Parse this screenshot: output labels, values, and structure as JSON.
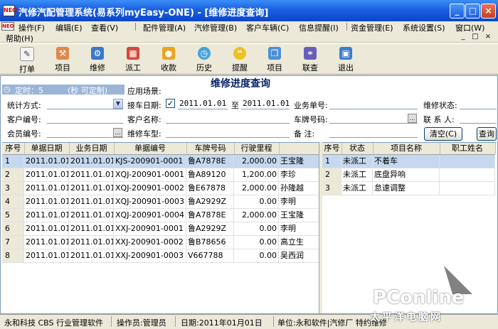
{
  "window": {
    "title": "汽修汽配管理系统(易系列myEasy-ONE) - [维修进度查询]",
    "controls": [
      "_",
      "□",
      "×"
    ]
  },
  "menu": {
    "items": [
      "操作(F)",
      "编辑(E)",
      "查看(V)",
      "配件管理(A)",
      "汽修管理(B)",
      "客户车辆(C)",
      "信息提醒(I)",
      "资金管理(E)",
      "系统设置(S)",
      "窗口(W)",
      "帮助(H)"
    ],
    "mdi_controls": [
      "_",
      "□",
      "×"
    ]
  },
  "toolbar": {
    "buttons": [
      {
        "label": "打单",
        "icon": "print-order-icon"
      },
      {
        "label": "项目",
        "icon": "hammer-icon"
      },
      {
        "label": "维修",
        "icon": "repair-icon"
      },
      {
        "label": "派工",
        "icon": "calendar-icon"
      },
      {
        "label": "收款",
        "icon": "payment-icon"
      },
      {
        "label": "历史",
        "icon": "clock-icon"
      },
      {
        "label": "提醒",
        "icon": "reminder-icon"
      },
      {
        "label": "项目",
        "icon": "project-icon"
      },
      {
        "label": "联查",
        "icon": "linked-query-icon"
      },
      {
        "label": "退出",
        "icon": "exit-icon"
      }
    ]
  },
  "form": {
    "title": "维修进度查询",
    "timer_label": "定时：5",
    "timer_hint": "(秒 可定制)",
    "scene_label": "应用场景:",
    "stat_mode_label": "统计方式:",
    "pickup_date_label": "接车日期:",
    "pickup_date_checked": "✓",
    "date_from": "2011.01.01",
    "to_label": "至",
    "date_to": "2011.01.01",
    "business_no_label": "业务单号:",
    "repair_status_label": "维修状态:",
    "customer_code_label": "客户编号:",
    "customer_name_label": "客户名称:",
    "plate_no_label": "车牌号码:",
    "contact_label": "联 系 人:",
    "member_no_label": "会员编号:",
    "repair_model_label": "维修车型:",
    "remark_label": "备    注:",
    "clear_button": "清空(C)",
    "query_button": "查询"
  },
  "left_grid": {
    "columns": [
      "序号",
      "单据日期",
      "业务日期",
      "单据编号",
      "车牌号码",
      "行驶里程",
      ""
    ],
    "rows": [
      [
        "1",
        "2011.01.01",
        "2011.01.01",
        "KJS-200901-0001",
        "鲁A7878E",
        "2,000.00",
        "王宝隆"
      ],
      [
        "2",
        "2011.01.01",
        "2011.01.01",
        "XQJ-200901-0001",
        "鲁A89120",
        "1,200.00",
        "李珍"
      ],
      [
        "3",
        "2011.01.01",
        "2011.01.01",
        "XQJ-200901-0002",
        "鲁E67878",
        "2,000.00",
        "孙隆越"
      ],
      [
        "4",
        "2011.01.01",
        "2011.01.01",
        "XQJ-200901-0003",
        "鲁A2929Z",
        "0.00",
        "李明"
      ],
      [
        "5",
        "2011.01.01",
        "2011.01.01",
        "XQJ-200901-0004",
        "鲁A7878E",
        "2,000.00",
        "王宝隆"
      ],
      [
        "6",
        "2011.01.01",
        "2011.01.01",
        "XXJ-200901-0001",
        "鲁A2929Z",
        "0.00",
        "李明"
      ],
      [
        "7",
        "2011.01.01",
        "2011.01.01",
        "XXJ-200901-0002",
        "鲁B78656",
        "0.00",
        "高立生"
      ],
      [
        "8",
        "2011.01.01",
        "2011.01.01",
        "XXJ-200901-0003",
        "V667788",
        "0.00",
        "吴西润"
      ]
    ]
  },
  "right_grid": {
    "columns": [
      "序号",
      "状态",
      "项目名称",
      "职工姓名"
    ],
    "rows": [
      [
        "1",
        "未派工",
        "不着车",
        ""
      ],
      [
        "2",
        "未派工",
        "底盘异响",
        ""
      ],
      [
        "3",
        "未派工",
        "怠速调整",
        ""
      ]
    ]
  },
  "statusbar": {
    "company": "永和科技 CBS 行业管理软件",
    "operator": "操作员:管理员",
    "date": "日期:2011年01月01日",
    "unit": "单位:永和软件|汽修厂 特约维修"
  },
  "watermark": {
    "brand": "PConline",
    "subtitle": "太平洋电脑网"
  },
  "colors": {
    "titlebar": "#0a46c9",
    "form_title": "#0a246a",
    "selected_row": "#c5d8f0"
  }
}
